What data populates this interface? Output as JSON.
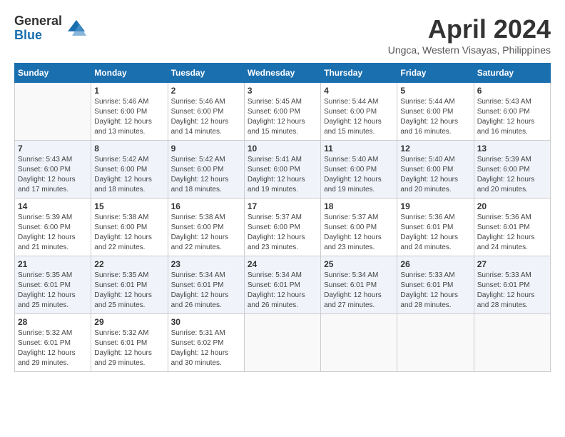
{
  "logo": {
    "general": "General",
    "blue": "Blue"
  },
  "title": "April 2024",
  "location": "Ungca, Western Visayas, Philippines",
  "days_header": [
    "Sunday",
    "Monday",
    "Tuesday",
    "Wednesday",
    "Thursday",
    "Friday",
    "Saturday"
  ],
  "weeks": [
    [
      {
        "day": "",
        "info": ""
      },
      {
        "day": "1",
        "info": "Sunrise: 5:46 AM\nSunset: 6:00 PM\nDaylight: 12 hours\nand 13 minutes."
      },
      {
        "day": "2",
        "info": "Sunrise: 5:46 AM\nSunset: 6:00 PM\nDaylight: 12 hours\nand 14 minutes."
      },
      {
        "day": "3",
        "info": "Sunrise: 5:45 AM\nSunset: 6:00 PM\nDaylight: 12 hours\nand 15 minutes."
      },
      {
        "day": "4",
        "info": "Sunrise: 5:44 AM\nSunset: 6:00 PM\nDaylight: 12 hours\nand 15 minutes."
      },
      {
        "day": "5",
        "info": "Sunrise: 5:44 AM\nSunset: 6:00 PM\nDaylight: 12 hours\nand 16 minutes."
      },
      {
        "day": "6",
        "info": "Sunrise: 5:43 AM\nSunset: 6:00 PM\nDaylight: 12 hours\nand 16 minutes."
      }
    ],
    [
      {
        "day": "7",
        "info": "Sunrise: 5:43 AM\nSunset: 6:00 PM\nDaylight: 12 hours\nand 17 minutes."
      },
      {
        "day": "8",
        "info": "Sunrise: 5:42 AM\nSunset: 6:00 PM\nDaylight: 12 hours\nand 18 minutes."
      },
      {
        "day": "9",
        "info": "Sunrise: 5:42 AM\nSunset: 6:00 PM\nDaylight: 12 hours\nand 18 minutes."
      },
      {
        "day": "10",
        "info": "Sunrise: 5:41 AM\nSunset: 6:00 PM\nDaylight: 12 hours\nand 19 minutes."
      },
      {
        "day": "11",
        "info": "Sunrise: 5:40 AM\nSunset: 6:00 PM\nDaylight: 12 hours\nand 19 minutes."
      },
      {
        "day": "12",
        "info": "Sunrise: 5:40 AM\nSunset: 6:00 PM\nDaylight: 12 hours\nand 20 minutes."
      },
      {
        "day": "13",
        "info": "Sunrise: 5:39 AM\nSunset: 6:00 PM\nDaylight: 12 hours\nand 20 minutes."
      }
    ],
    [
      {
        "day": "14",
        "info": "Sunrise: 5:39 AM\nSunset: 6:00 PM\nDaylight: 12 hours\nand 21 minutes."
      },
      {
        "day": "15",
        "info": "Sunrise: 5:38 AM\nSunset: 6:00 PM\nDaylight: 12 hours\nand 22 minutes."
      },
      {
        "day": "16",
        "info": "Sunrise: 5:38 AM\nSunset: 6:00 PM\nDaylight: 12 hours\nand 22 minutes."
      },
      {
        "day": "17",
        "info": "Sunrise: 5:37 AM\nSunset: 6:00 PM\nDaylight: 12 hours\nand 23 minutes."
      },
      {
        "day": "18",
        "info": "Sunrise: 5:37 AM\nSunset: 6:00 PM\nDaylight: 12 hours\nand 23 minutes."
      },
      {
        "day": "19",
        "info": "Sunrise: 5:36 AM\nSunset: 6:01 PM\nDaylight: 12 hours\nand 24 minutes."
      },
      {
        "day": "20",
        "info": "Sunrise: 5:36 AM\nSunset: 6:01 PM\nDaylight: 12 hours\nand 24 minutes."
      }
    ],
    [
      {
        "day": "21",
        "info": "Sunrise: 5:35 AM\nSunset: 6:01 PM\nDaylight: 12 hours\nand 25 minutes."
      },
      {
        "day": "22",
        "info": "Sunrise: 5:35 AM\nSunset: 6:01 PM\nDaylight: 12 hours\nand 25 minutes."
      },
      {
        "day": "23",
        "info": "Sunrise: 5:34 AM\nSunset: 6:01 PM\nDaylight: 12 hours\nand 26 minutes."
      },
      {
        "day": "24",
        "info": "Sunrise: 5:34 AM\nSunset: 6:01 PM\nDaylight: 12 hours\nand 26 minutes."
      },
      {
        "day": "25",
        "info": "Sunrise: 5:34 AM\nSunset: 6:01 PM\nDaylight: 12 hours\nand 27 minutes."
      },
      {
        "day": "26",
        "info": "Sunrise: 5:33 AM\nSunset: 6:01 PM\nDaylight: 12 hours\nand 28 minutes."
      },
      {
        "day": "27",
        "info": "Sunrise: 5:33 AM\nSunset: 6:01 PM\nDaylight: 12 hours\nand 28 minutes."
      }
    ],
    [
      {
        "day": "28",
        "info": "Sunrise: 5:32 AM\nSunset: 6:01 PM\nDaylight: 12 hours\nand 29 minutes."
      },
      {
        "day": "29",
        "info": "Sunrise: 5:32 AM\nSunset: 6:01 PM\nDaylight: 12 hours\nand 29 minutes."
      },
      {
        "day": "30",
        "info": "Sunrise: 5:31 AM\nSunset: 6:02 PM\nDaylight: 12 hours\nand 30 minutes."
      },
      {
        "day": "",
        "info": ""
      },
      {
        "day": "",
        "info": ""
      },
      {
        "day": "",
        "info": ""
      },
      {
        "day": "",
        "info": ""
      }
    ]
  ]
}
